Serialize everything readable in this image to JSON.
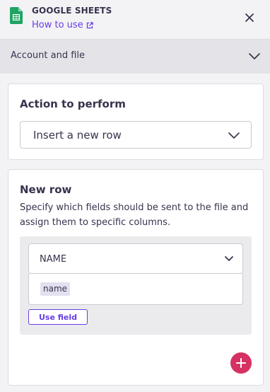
{
  "header": {
    "app_title": "GOOGLE SHEETS",
    "how_to_use_label": "How to use"
  },
  "account": {
    "label": "Account and file"
  },
  "action_card": {
    "title": "Action to perform",
    "selected_action": "Insert a new row"
  },
  "new_row_card": {
    "title": "New row",
    "description": "Specify which fields should be sent to the file and assign them to specific columns.",
    "column_value": "NAME",
    "field_chip": "name",
    "use_field_label": "Use field"
  },
  "colors": {
    "accent": "#673de6",
    "add_button": "#d63163",
    "sheets_green": "#1fa463"
  },
  "icons": {
    "app": "google-sheets-icon",
    "external": "external-link-icon",
    "close": "close-icon",
    "chevron": "chevron-down-icon",
    "add": "plus-icon"
  }
}
